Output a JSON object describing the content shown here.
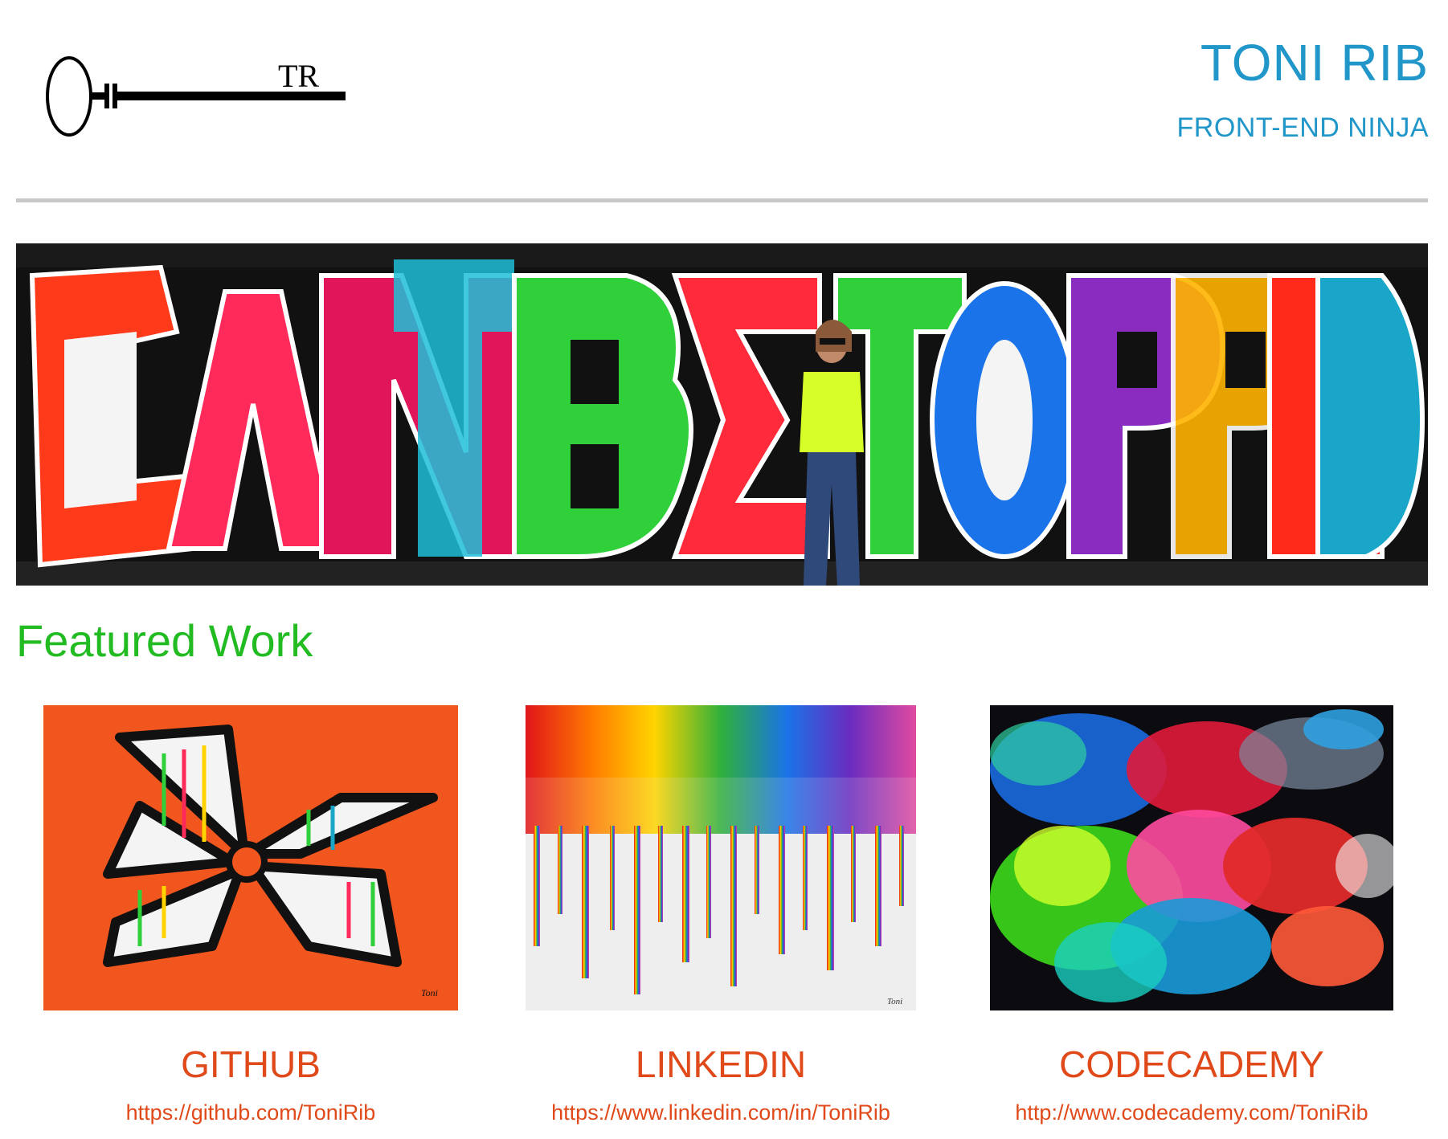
{
  "header": {
    "logo_initials": "TR",
    "name": "TONI RIB",
    "tagline": "FRONT-END NINJA"
  },
  "hero": {
    "image_icon": "graffiti-banner-image"
  },
  "featured": {
    "title": "Featured Work",
    "cards": [
      {
        "label": "GITHUB",
        "url": "https://github.com/ToniRib",
        "signature": "Toni"
      },
      {
        "label": "LINKEDIN",
        "url": "https://www.linkedin.com/in/ToniRib",
        "signature": "Toni"
      },
      {
        "label": "CODECADEMY",
        "url": "http://www.codecademy.com/ToniRib"
      }
    ]
  },
  "colors": {
    "brand_blue": "#2196c9",
    "section_green": "#22bb22",
    "link_orange": "#e04a1a",
    "rule_gray": "#c8c8c8"
  }
}
